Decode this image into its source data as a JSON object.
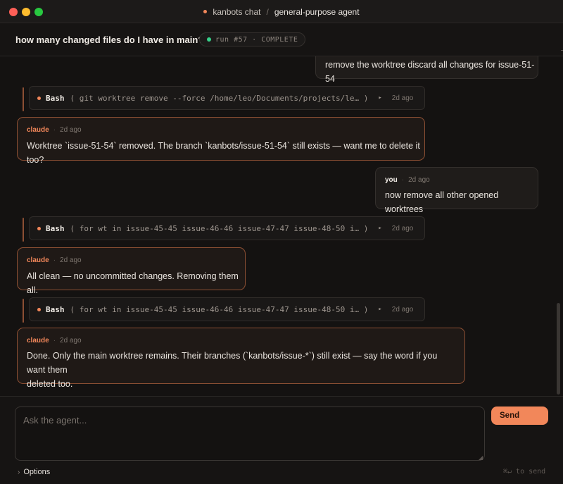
{
  "window": {
    "app_name": "kanbots chat",
    "separator": "/",
    "agent_name": "general-purpose agent"
  },
  "header": {
    "question": "how many changed files do I have in main?",
    "run_badge": "run #57 · COMPLETE",
    "status_color": "#36d18a"
  },
  "messages": {
    "m0": {
      "text": "remove the worktree discard all changes for issue-51-54"
    },
    "t1": {
      "tool": "Bash",
      "command": "( git worktree remove --force /home/leo/Documents/projects/le… )",
      "play": "▸",
      "time": "2d ago"
    },
    "m2": {
      "author": "claude",
      "dot": "·",
      "time": "2d ago",
      "text": "Worktree `issue-51-54` removed. The branch `kanbots/issue-51-54` still exists — want me to delete it too?"
    },
    "m3": {
      "author": "you",
      "dot": "·",
      "time": "2d ago",
      "text": "now remove all other opened worktrees"
    },
    "t4": {
      "tool": "Bash",
      "command": "( for wt in issue-45-45 issue-46-46 issue-47-47 issue-48-50 i… )",
      "play": "▸",
      "time": "2d ago"
    },
    "m5": {
      "author": "claude",
      "dot": "·",
      "time": "2d ago",
      "text": "All clean — no uncommitted changes. Removing them all."
    },
    "t6": {
      "tool": "Bash",
      "command": "( for wt in issue-45-45 issue-46-46 issue-47-47 issue-48-50 i… )",
      "play": "▸",
      "time": "2d ago"
    },
    "m7": {
      "author": "claude",
      "dot": "·",
      "time": "2d ago",
      "text_line1": "Done. Only the main worktree remains. Their branches (`kanbots/issue-*`) still exist — say the word if you want them",
      "text_line2": "deleted too."
    }
  },
  "composer": {
    "placeholder": "Ask the agent...",
    "send_label": "Send",
    "options_label": "Options",
    "hint": "⌘↵ to send"
  },
  "colors": {
    "accent": "#f2875a",
    "claude_border": "#8c4f33"
  }
}
